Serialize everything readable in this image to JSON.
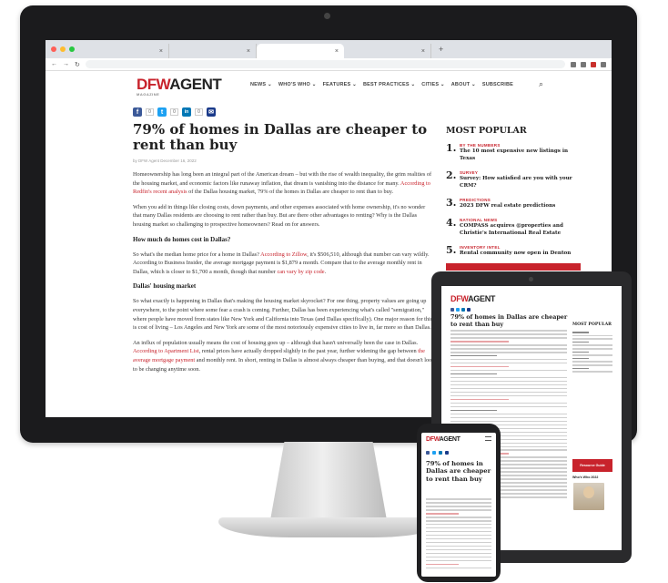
{
  "site": {
    "logo_dfw": "DFW",
    "logo_agent": "AGENT",
    "logo_tag": "MAGAZINE",
    "nav": [
      "NEWS ⌄",
      "WHO'S WHO ⌄",
      "FEATURES ⌄",
      "BEST PRACTICES ⌄",
      "CITIES ⌄",
      "ABOUT ⌄",
      "SUBSCRIBE"
    ]
  },
  "browser": {
    "tabs": [
      "×",
      "×",
      "×",
      "×"
    ],
    "newtab": "+"
  },
  "share": {
    "facebook": "f",
    "facebook_count": "0",
    "twitter": "t",
    "twitter_count": "0",
    "linkedin": "in",
    "linkedin_count": "0",
    "email": "✉"
  },
  "article": {
    "title": "79% of homes in Dallas are cheaper to rent than buy",
    "byline": "by DFW Agent    December 16, 2022",
    "p1": "Homeownership has long been an integral part of the American dream – but with the rise of wealth inequality, the grim realities of the housing market, and economic factors like runaway inflation, that dream is vanishing into the distance for many.",
    "p1_link": "According to Redfin's recent analysis",
    "p1_tail": "of the Dallas housing market, 79% of the homes in Dallas are cheaper to rent than to buy.",
    "p2": "When you add in things like closing costs, down payments, and other expenses associated with home ownership, it's no wonder that many Dallas residents are choosing to rent rather than buy. But are there other advantages to renting? Why is the Dallas housing market so challenging to prospective homeowners? Read on for answers.",
    "h1": "How much do homes cost in Dallas?",
    "p3_a": "So what's the median home price for a home in Dallas?",
    "p3_link": "According to Zillow",
    "p3_b": ", it's $506,510, although that number can vary wildly. According to Business Insider, the average mortgage payment is $1,879 a month. Compare that to the average monthly rent in Dallas, which is closer to $1,700 a month, though that number",
    "p3_link2": "can vary by zip code",
    "h2": "Dallas' housing market",
    "p4": "So what exactly is happening in Dallas that's making the housing market skyrocket? For one thing, property values are going up everywhere, to the point where some fear a crash is coming. Further, Dallas has been experiencing what's called \"semigration,\" where people have moved from states like New York and California into Texas (and Dallas specifically). One major reason for this is cost of living – Los Angeles and New York are some of the most notoriously expensive cities to live in, far more so than Dallas.",
    "p5_a": "An influx of population usually means the cost of housing goes up – although that hasn't universally been the case in Dallas.",
    "p5_link": "According to Apartment List",
    "p5_b": ", rental prices have actually dropped slightly in the past year, further widening the gap between",
    "p5_link2": "the average mortgage payment",
    "p5_c": "and monthly rent. In short, renting in Dallas is almost always cheaper than buying, and that doesn't look to be changing anytime soon."
  },
  "most_popular": {
    "title": "MOST POPULAR",
    "items": [
      {
        "num": "1.",
        "category": "BY THE NUMBERS",
        "headline": "The 10 most expensive new listings in Texas"
      },
      {
        "num": "2.",
        "category": "SURVEY",
        "headline": "Survey: How satisfied are you with your CRM?"
      },
      {
        "num": "3.",
        "category": "PREDICTIONS",
        "headline": "2023 DFW real estate predictions"
      },
      {
        "num": "4.",
        "category": "NATIONAL NEWS",
        "headline": "COMPASS acquires @properties and Christie's International Real Estate"
      },
      {
        "num": "5.",
        "category": "INVENTORY INTEL",
        "headline": "Rental community now open in Denton"
      }
    ]
  },
  "tablet": {
    "title": "79% of homes in Dallas are cheaper to rent than buy",
    "most_popular": "MOST POPULAR",
    "redbox": "Resource Guide",
    "who": "Who's Who 2022"
  },
  "phone": {
    "title": "79% of homes in Dallas are cheaper to rent than buy"
  },
  "colors": {
    "brand_red": "#c8232c",
    "facebook": "#3b5998",
    "twitter": "#1da1f2",
    "linkedin": "#0077b5",
    "email": "#1a3a8a"
  }
}
